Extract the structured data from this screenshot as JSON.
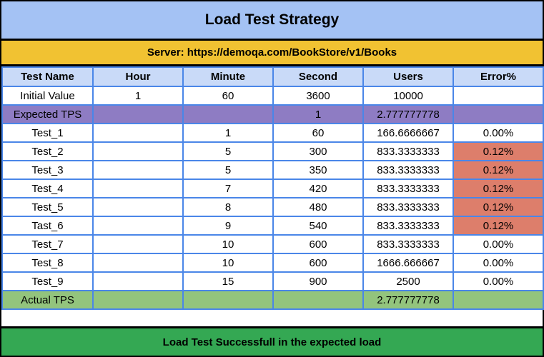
{
  "title": "Load Test Strategy",
  "server": "Server: https://demoqa.com/BookStore/v1/Books",
  "columns": [
    "Test Name",
    "Hour",
    "Minute",
    "Second",
    "Users",
    "Error%"
  ],
  "rows": [
    {
      "name": "Initial Value",
      "hour": "1",
      "minute": "60",
      "second": "3600",
      "users": "10000",
      "error": "",
      "style": "plain"
    },
    {
      "name": "Expected TPS",
      "hour": "",
      "minute": "",
      "second": "1",
      "users": "2.777777778",
      "error": "",
      "style": "expected"
    },
    {
      "name": "Test_1",
      "hour": "",
      "minute": "1",
      "second": "60",
      "users": "166.6666667",
      "error": "0.00%",
      "style": "plain"
    },
    {
      "name": "Test_2",
      "hour": "",
      "minute": "5",
      "second": "300",
      "users": "833.3333333",
      "error": "0.12%",
      "style": "error"
    },
    {
      "name": "Test_3",
      "hour": "",
      "minute": "5",
      "second": "350",
      "users": "833.3333333",
      "error": "0.12%",
      "style": "error"
    },
    {
      "name": "Test_4",
      "hour": "",
      "minute": "7",
      "second": "420",
      "users": "833.3333333",
      "error": "0.12%",
      "style": "error"
    },
    {
      "name": "Test_5",
      "hour": "",
      "minute": "8",
      "second": "480",
      "users": "833.3333333",
      "error": "0.12%",
      "style": "error"
    },
    {
      "name": "Tast_6",
      "hour": "",
      "minute": "9",
      "second": "540",
      "users": "833.3333333",
      "error": "0.12%",
      "style": "error"
    },
    {
      "name": "Test_7",
      "hour": "",
      "minute": "10",
      "second": "600",
      "users": "833.3333333",
      "error": "0.00%",
      "style": "plain"
    },
    {
      "name": "Test_8",
      "hour": "",
      "minute": "10",
      "second": "600",
      "users": "1666.666667",
      "error": "0.00%",
      "style": "plain"
    },
    {
      "name": "Test_9",
      "hour": "",
      "minute": "15",
      "second": "900",
      "users": "2500",
      "error": "0.00%",
      "style": "plain"
    },
    {
      "name": "Actual TPS",
      "hour": "",
      "minute": "",
      "second": "",
      "users": "2.777777778",
      "error": "",
      "style": "actual"
    }
  ],
  "footer": "Load Test Successfull in the expected load",
  "colors": {
    "title_bg": "#a4c2f4",
    "server_bg": "#f1c232",
    "header_bg": "#c9daf8",
    "expected_bg": "#8e7cc3",
    "error_bg": "#dd7e6b",
    "actual_bg": "#93c47d",
    "footer_bg": "#34a853",
    "grid_border": "#4a86e8"
  }
}
